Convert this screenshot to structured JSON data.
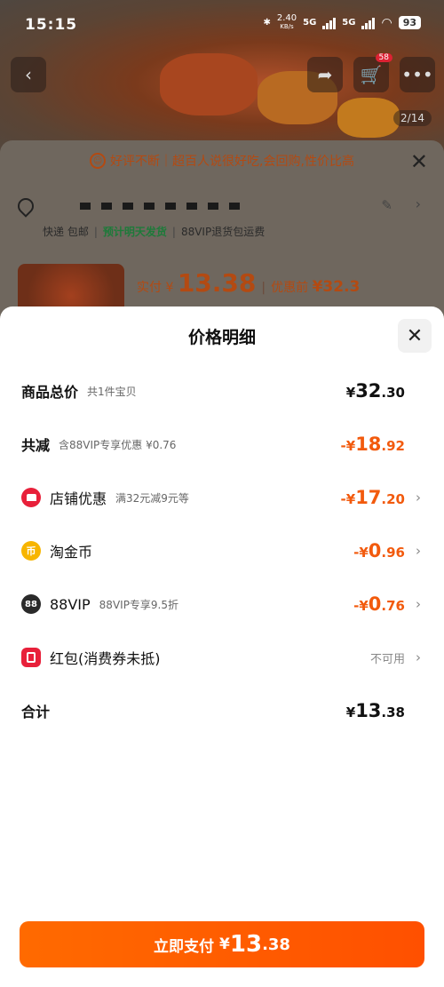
{
  "status_bar": {
    "time": "15:15",
    "net_speed": "2.40",
    "net_unit": "KB/s",
    "sim1": "5G",
    "sim2": "5G",
    "battery": "93"
  },
  "product_page": {
    "cart_badge": "58",
    "image_counter": "2/14",
    "promo_text": "好评不断｜超百人说很好吃,会回购,性价比高",
    "shipping": {
      "express": "快递 包邮",
      "delivery": "预计明天发货",
      "return": "88VIP退货包运费"
    },
    "price": {
      "paid_label": "实付",
      "paid_yen": "¥",
      "paid_value": "13.38",
      "before_label": "优惠前",
      "before_value": "¥32.3"
    }
  },
  "modal": {
    "title": "价格明细",
    "rows": [
      {
        "label": "商品总价",
        "sub": "共1件宝贝",
        "yen": "¥",
        "int": "32",
        "dec": ".30",
        "sign": ""
      },
      {
        "label": "共减",
        "sub": "含88VIP专享优惠 ¥0.76",
        "yen": "¥",
        "int": "18",
        "dec": ".92",
        "sign": "-"
      },
      {
        "label": "店铺优惠",
        "sub": "满32元减9元等",
        "yen": "¥",
        "int": "17",
        "dec": ".20",
        "sign": "-"
      },
      {
        "label": "淘金币",
        "sub": "",
        "yen": "¥",
        "int": "0",
        "dec": ".96",
        "sign": "-"
      },
      {
        "label": "88VIP",
        "sub": "88VIP专享9.5折",
        "yen": "¥",
        "int": "0",
        "dec": ".76",
        "sign": "-"
      },
      {
        "label": "红包(消费券未抵)",
        "sub": "",
        "status": "不可用"
      },
      {
        "label": "合计",
        "sub": "",
        "yen": "¥",
        "int": "13",
        "dec": ".38",
        "sign": ""
      }
    ],
    "icons": {
      "coin_glyph": "币",
      "vip_glyph": "88"
    },
    "pay_button": {
      "label": "立即支付",
      "yen": "¥",
      "int": "13",
      "dec": ".38"
    }
  },
  "colors": {
    "accent": "#ff5000",
    "discount": "#f25a0d",
    "shop_icon": "#e8203a",
    "coin_icon": "#f7b500"
  }
}
